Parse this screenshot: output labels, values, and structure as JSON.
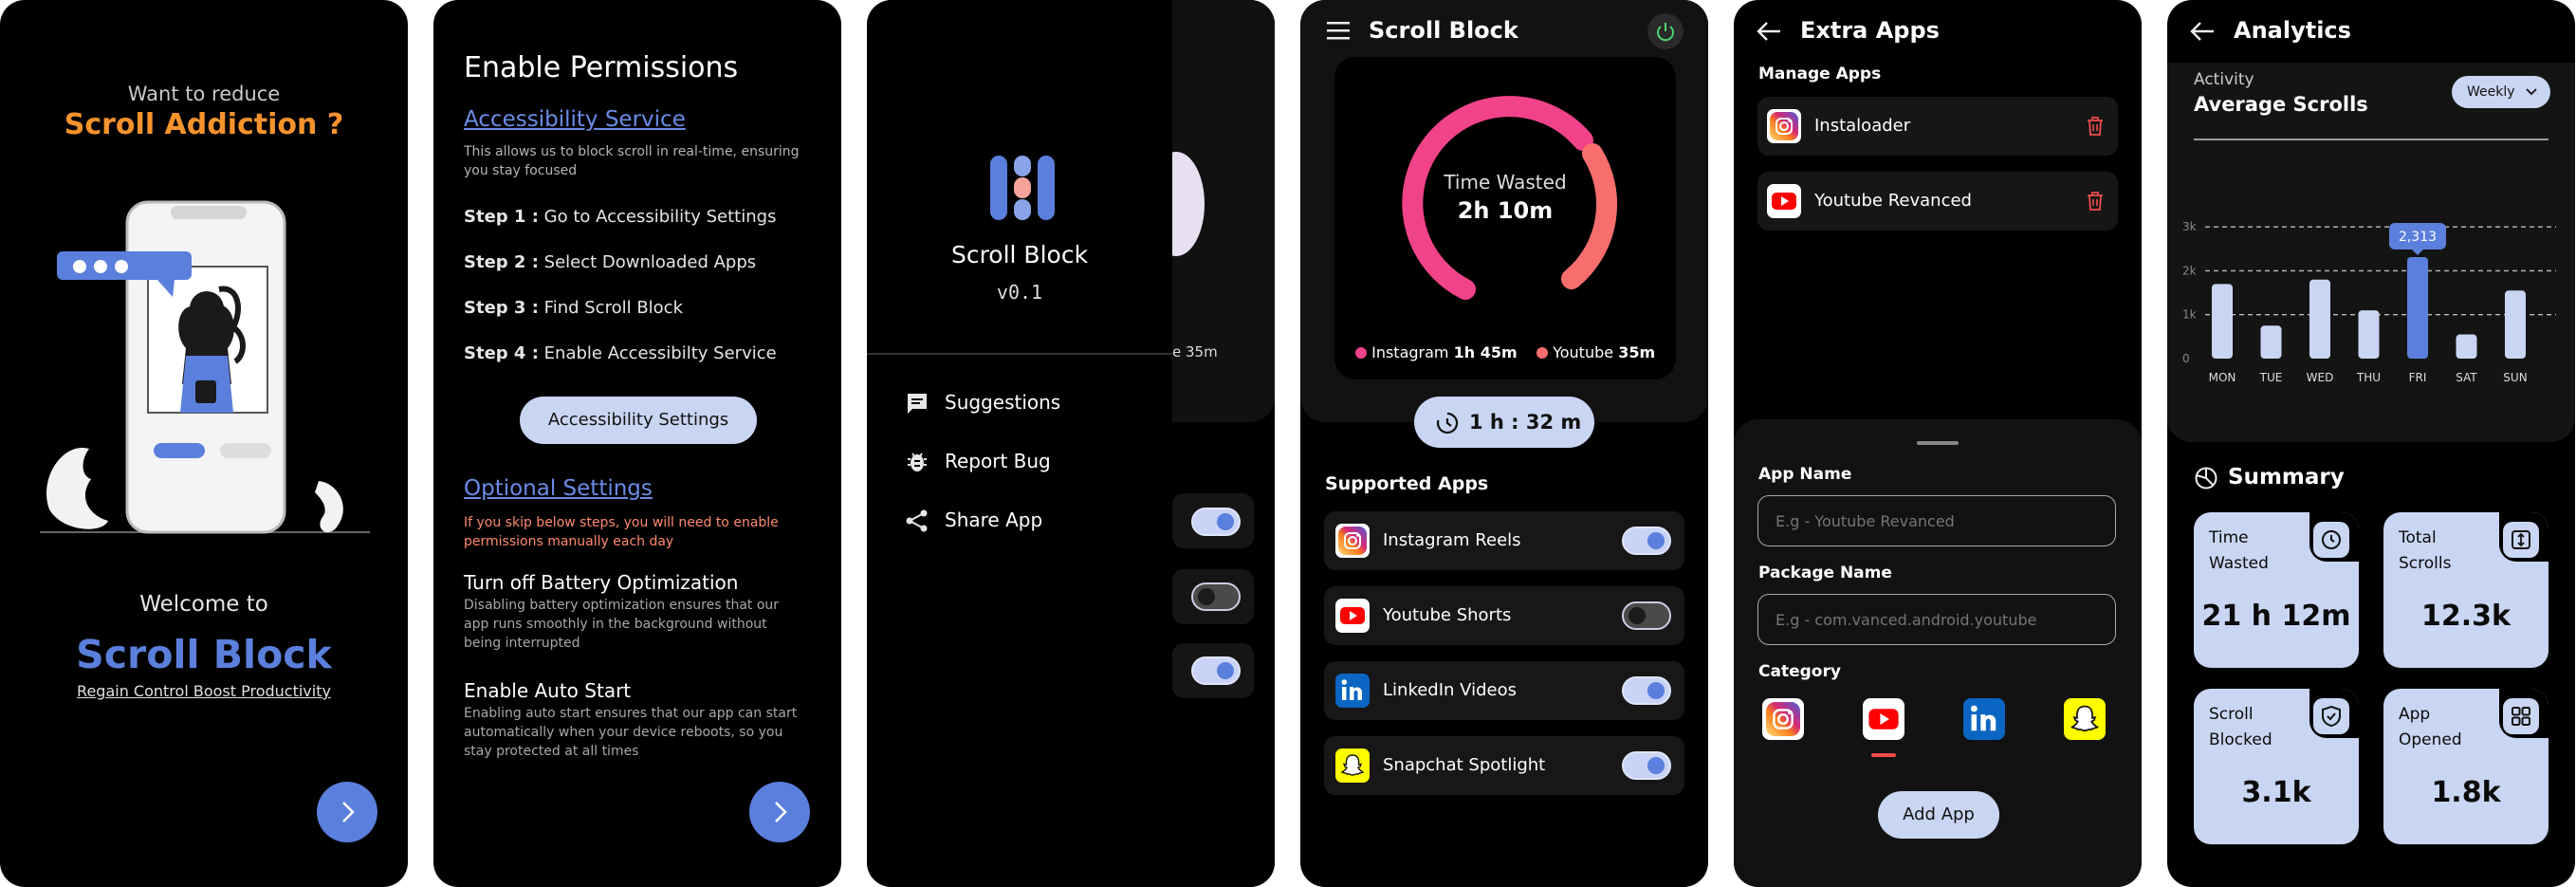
{
  "colors": {
    "accent": "#5b7fdc",
    "orange": "#f7932d",
    "pink": "#f0438a",
    "coral": "#f86e6e",
    "pale": "#c9d6f3",
    "red": "#f04c4c"
  },
  "s1": {
    "subtitle": "Want to reduce",
    "headline": "Scroll Addiction ?",
    "welcome": "Welcome to",
    "app_name": "Scroll Block",
    "tagline": "Regain Control  Boost Productivity"
  },
  "s2": {
    "title": "Enable Permissions",
    "acc_title": "Accessibility Service",
    "acc_desc": "This allows us to block scroll in real-time, ensuring you stay focused",
    "steps": [
      {
        "label": "Step 1 :",
        "text": "Go to Accessibility Settings"
      },
      {
        "label": "Step 2 :",
        "text": "Select Downloaded Apps"
      },
      {
        "label": "Step 3 :",
        "text": "Find Scroll Block"
      },
      {
        "label": "Step 4 :",
        "text": "Enable Accessibilty Service"
      }
    ],
    "acc_button": "Accessibility Settings",
    "opt_title": "Optional Settings",
    "opt_warning": "If you skip below steps, you will need to enable permissions manually each day",
    "battery_title": "Turn off Battery Optimization",
    "battery_desc": "Disabling battery optimization ensures that our app runs smoothly in the background without being interrupted",
    "autostart_title": "Enable Auto Start",
    "autostart_desc": "Enabling auto start ensures that our app can start automatically when your device reboots, so you stay protected at all times"
  },
  "s3": {
    "app_name": "Scroll Block",
    "version": "v0.1",
    "peek_text": "e 35m",
    "menu": [
      {
        "icon": "chat-icon",
        "label": "Suggestions"
      },
      {
        "icon": "bug-icon",
        "label": "Report Bug"
      },
      {
        "icon": "share-icon",
        "label": "Share App"
      }
    ]
  },
  "s4": {
    "title": "Scroll Block",
    "ring_label": "Time Wasted",
    "ring_value": "2h 10m",
    "legend": [
      {
        "name": "Instagram",
        "value": "1h 45m",
        "color": "#f0438a"
      },
      {
        "name": "Youtube",
        "value": "35m",
        "color": "#f86e6e"
      }
    ],
    "timer": "1 h : 32 m",
    "section": "Supported Apps",
    "apps": [
      {
        "name": "Instagram Reels",
        "icon": "instagram-icon",
        "on": true
      },
      {
        "name": "Youtube Shorts",
        "icon": "youtube-icon",
        "on": false
      },
      {
        "name": "LinkedIn Videos",
        "icon": "linkedin-icon",
        "on": true
      },
      {
        "name": "Snapchat Spotlight",
        "icon": "snapchat-icon",
        "on": true
      }
    ]
  },
  "s5": {
    "title": "Extra Apps",
    "section": "Manage Apps",
    "apps": [
      {
        "name": "Instaloader",
        "icon": "instagram-icon"
      },
      {
        "name": "Youtube Revanced",
        "icon": "youtube-icon"
      }
    ],
    "app_name_label": "App Name",
    "app_name_placeholder": "E.g - Youtube Revanced",
    "package_label": "Package Name",
    "package_placeholder": "E.g - com.vanced.android.youtube",
    "category_label": "Category",
    "categories": [
      "instagram-icon",
      "youtube-icon",
      "linkedin-icon",
      "snapchat-icon"
    ],
    "selected_category": "youtube-icon",
    "add_button": "Add App"
  },
  "s6": {
    "title": "Analytics",
    "activity": "Activity",
    "metric": "Average Scrolls",
    "period": "Weekly",
    "summary": "Summary",
    "cards": [
      {
        "label": "Time Wasted",
        "value": "21 h 12m",
        "icon": "clock-icon"
      },
      {
        "label": "Total Scrolls",
        "value": "12.3k",
        "icon": "scroll-icon"
      },
      {
        "label": "Scroll Blocked",
        "value": "3.1k",
        "icon": "shield-icon"
      },
      {
        "label": "App Opened",
        "value": "1.8k",
        "icon": "grid-icon"
      }
    ]
  },
  "chart_data": {
    "type": "bar",
    "categories": [
      "MON",
      "TUE",
      "WED",
      "THU",
      "FRI",
      "SAT",
      "SUN"
    ],
    "values": [
      1700,
      750,
      1800,
      1100,
      2313,
      550,
      1550
    ],
    "highlight": "FRI",
    "highlight_label": "2,313",
    "yticks": [
      "0",
      "1k",
      "2k",
      "3k"
    ],
    "ylim": [
      0,
      3000
    ],
    "grid": "dashed"
  }
}
